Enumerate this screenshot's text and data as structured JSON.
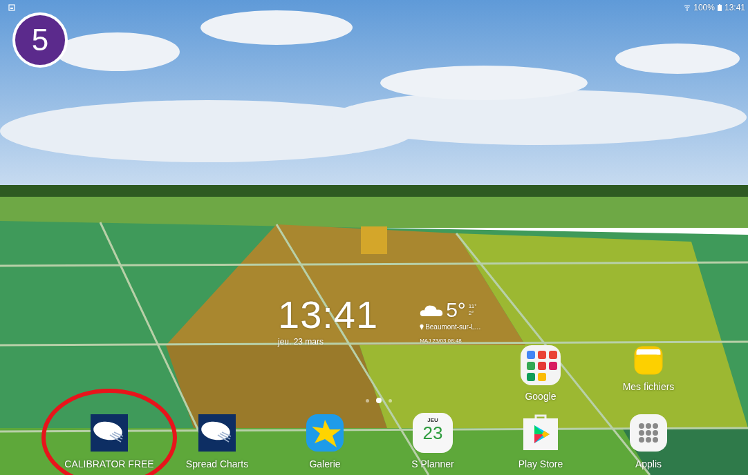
{
  "step_badge": {
    "number": "5"
  },
  "status_bar": {
    "battery": "100%",
    "time": "13:41"
  },
  "clock_widget": {
    "time": "13:41",
    "date": "jeu. 23 mars"
  },
  "weather_widget": {
    "temperature": "5°",
    "high": "11°",
    "low": "2°",
    "location": "Beaumont-sur-L...",
    "updated": "MAJ 23/03 08:48"
  },
  "home_apps": [
    {
      "kind": "google-folder",
      "label": "Google"
    },
    {
      "kind": "files",
      "label": "Mes fichiers"
    }
  ],
  "pages": [
    {
      "selected": false
    },
    {
      "selected": true
    },
    {
      "selected": false
    }
  ],
  "dock_apps": [
    {
      "kind": "calibrator",
      "label": "CALIBRATOR FREE",
      "circled": true
    },
    {
      "kind": "calibrator",
      "label": "Spread Charts",
      "circled": false
    },
    {
      "kind": "gallery",
      "label": "Galerie",
      "circled": false
    },
    {
      "kind": "planner",
      "label": "S Planner",
      "circled": false,
      "day": "JEU",
      "date": "23"
    },
    {
      "kind": "store",
      "label": "Play Store",
      "circled": false
    },
    {
      "kind": "apps",
      "label": "Applis",
      "circled": false
    }
  ]
}
